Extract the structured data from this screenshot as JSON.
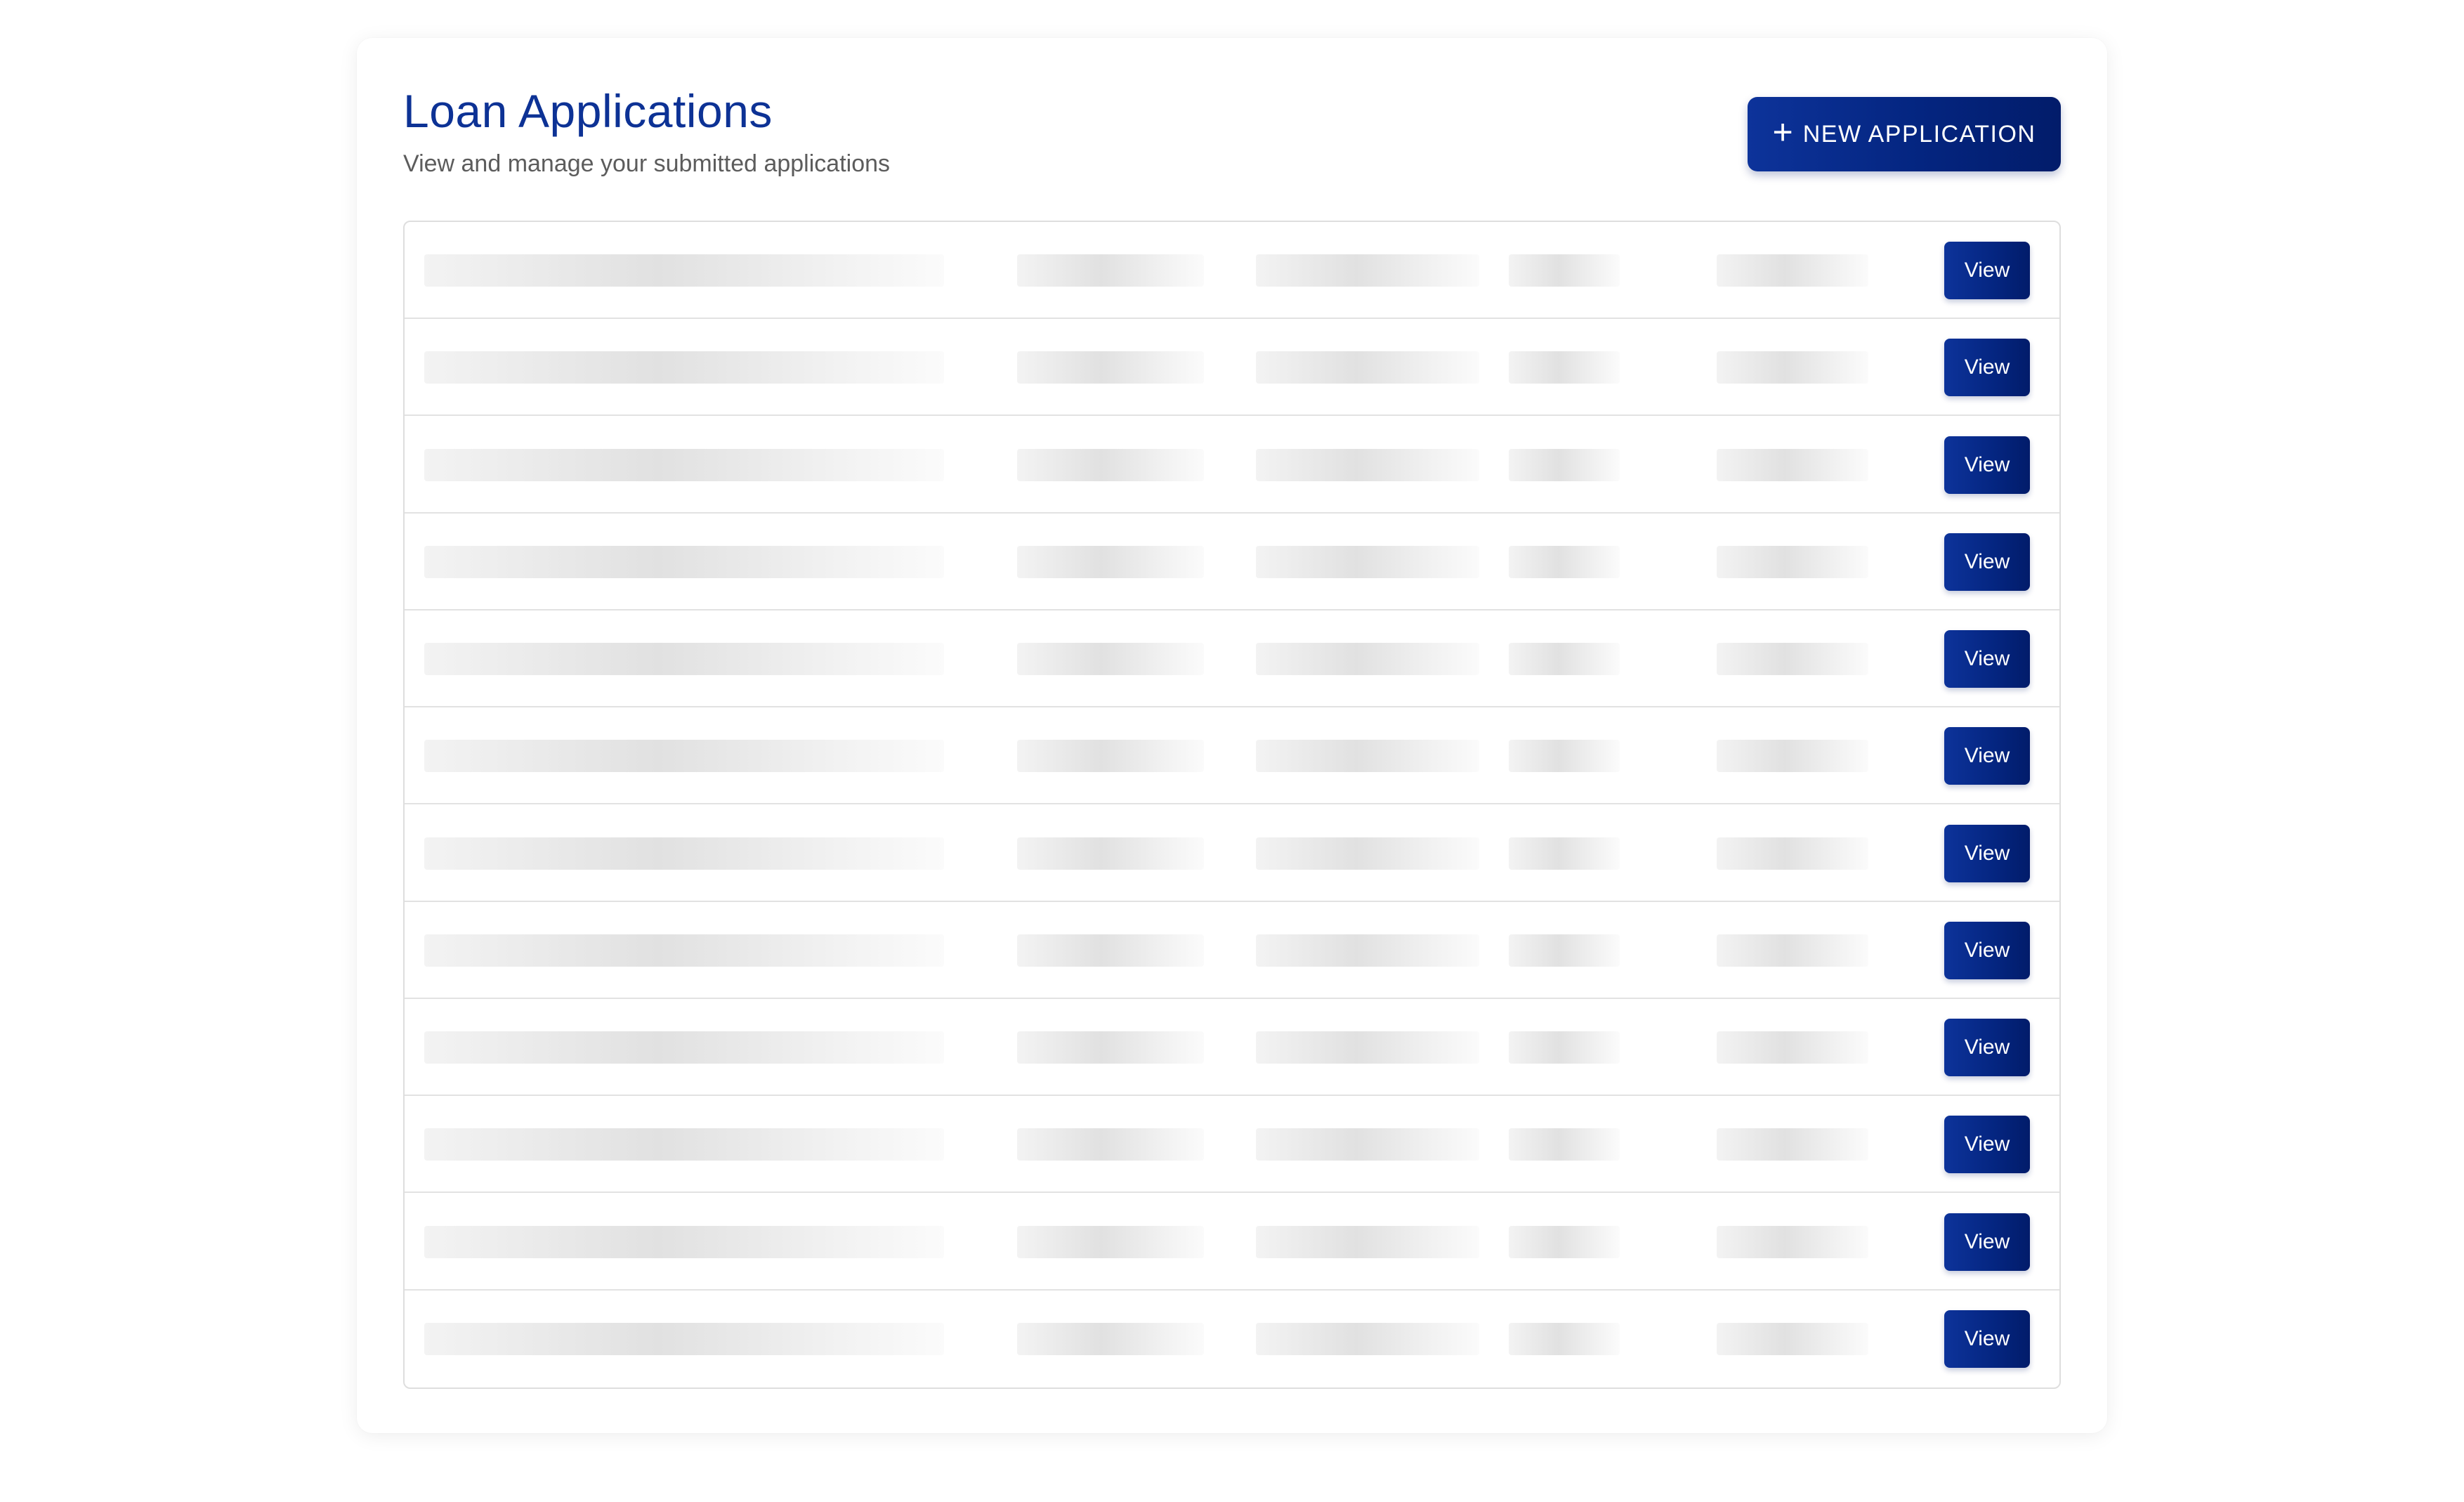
{
  "header": {
    "title": "Loan Applications",
    "subtitle": "View and manage your submitted applications",
    "new_button_label": "NEW APPLICATION",
    "new_button_icon": "plus-icon"
  },
  "table": {
    "state": "loading",
    "rows": [
      {
        "action_label": "View"
      },
      {
        "action_label": "View"
      },
      {
        "action_label": "View"
      },
      {
        "action_label": "View"
      },
      {
        "action_label": "View"
      },
      {
        "action_label": "View"
      },
      {
        "action_label": "View"
      },
      {
        "action_label": "View"
      },
      {
        "action_label": "View"
      },
      {
        "action_label": "View"
      },
      {
        "action_label": "View"
      },
      {
        "action_label": "View"
      }
    ]
  },
  "colors": {
    "primary": "#0d339a",
    "primary_dark": "#021c6a",
    "title": "#0d3295",
    "subtitle": "#5c5c5c",
    "skeleton": "#e1e1e1",
    "border": "#dedede"
  }
}
